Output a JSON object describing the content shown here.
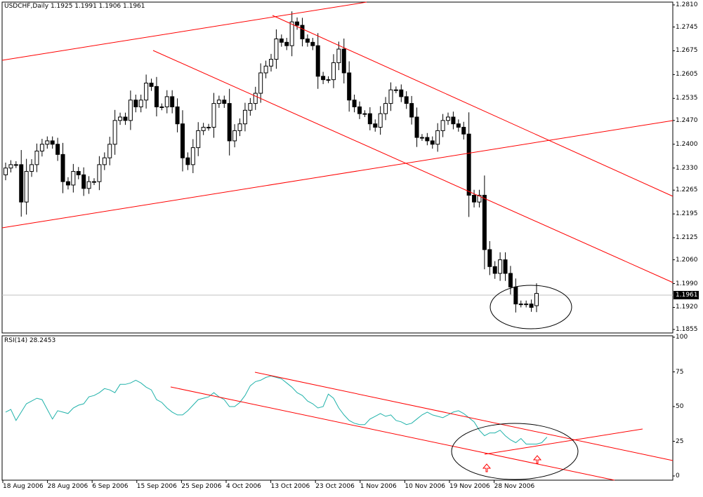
{
  "main_panel": {
    "header": "USDCHF,Daily  1.1925 1.1991 1.1906 1.1961",
    "current_price_label": "1.1961",
    "price_ticks": [
      "1.2810",
      "1.2745",
      "1.2675",
      "1.2605",
      "1.2535",
      "1.2470",
      "1.2400",
      "1.2330",
      "1.2265",
      "1.2195",
      "1.2125",
      "1.2060",
      "1.1990",
      "1.1920",
      "1.1855"
    ]
  },
  "rsi_panel": {
    "header": "RSI(14)  28.2453",
    "ticks": [
      "100",
      "75",
      "50",
      "25",
      "0"
    ]
  },
  "x_axis": {
    "labels": [
      "18 Aug 2006",
      "28 Aug 2006",
      "6 Sep 2006",
      "15 Sep 2006",
      "25 Sep 2006",
      "4 Oct 2006",
      "13 Oct 2006",
      "23 Oct 2006",
      "1 Nov 2006",
      "10 Nov 2006",
      "19 Nov 2006",
      "28 Nov 2006"
    ]
  },
  "colors": {
    "up_candle": "#ffffff",
    "down_candle": "#000000",
    "trendline": "#ff0000",
    "rsi_line": "#20b2aa",
    "arrow": "#ff0000"
  },
  "chart_data": [
    {
      "type": "candlestick",
      "title": "USDCHF,Daily",
      "symbol": "USDCHF",
      "timeframe": "Daily",
      "last_bar": {
        "open": 1.1925,
        "high": 1.1991,
        "low": 1.1906,
        "close": 1.1961
      },
      "ylim": [
        1.1855,
        1.281
      ],
      "x_labels": [
        "18 Aug 2006",
        "28 Aug 2006",
        "6 Sep 2006",
        "15 Sep 2006",
        "25 Sep 2006",
        "4 Oct 2006",
        "13 Oct 2006",
        "23 Oct 2006",
        "1 Nov 2006",
        "10 Nov 2006",
        "19 Nov 2006",
        "28 Nov 2006"
      ],
      "grid": false,
      "close": [
        1.233,
        1.234,
        1.234,
        1.223,
        1.232,
        1.234,
        1.238,
        1.24,
        1.241,
        1.24,
        1.237,
        1.229,
        1.228,
        1.232,
        1.231,
        1.227,
        1.229,
        1.229,
        1.234,
        1.236,
        1.24,
        1.247,
        1.248,
        1.247,
        1.253,
        1.251,
        1.253,
        1.258,
        1.257,
        1.251,
        1.251,
        1.254,
        1.251,
        1.246,
        1.236,
        1.234,
        1.239,
        1.244,
        1.245,
        1.245,
        1.252,
        1.253,
        1.252,
        1.241,
        1.244,
        1.246,
        1.25,
        1.252,
        1.255,
        1.261,
        1.263,
        1.265,
        1.271,
        1.27,
        1.269,
        1.276,
        1.275,
        1.271,
        1.27,
        1.269,
        1.26,
        1.259,
        1.259,
        1.264,
        1.268,
        1.261,
        1.253,
        1.251,
        1.249,
        1.249,
        1.246,
        1.245,
        1.249,
        1.252,
        1.256,
        1.256,
        1.254,
        1.252,
        1.248,
        1.242,
        1.242,
        1.241,
        1.24,
        1.244,
        1.247,
        1.248,
        1.246,
        1.245,
        1.243,
        1.225,
        1.223,
        1.225,
        1.209,
        1.204,
        1.202,
        1.206,
        1.202,
        1.198,
        1.193,
        1.193,
        1.193,
        1.192,
        1.1961
      ],
      "rsi_series": [
        46,
        48,
        40,
        46,
        52,
        54,
        56,
        55,
        48,
        41,
        47,
        46,
        45,
        49,
        51,
        52,
        57,
        58,
        60,
        63,
        62,
        60,
        66,
        66,
        67,
        69,
        67,
        64,
        62,
        55,
        53,
        49,
        46,
        44,
        44,
        47,
        51,
        55,
        56,
        57,
        60,
        57,
        55,
        50,
        50,
        53,
        58,
        65,
        68,
        69,
        71,
        72,
        71,
        70,
        67,
        64,
        60,
        58,
        54,
        52,
        49,
        50,
        59,
        56,
        49,
        44,
        40,
        38,
        37,
        37,
        41,
        43,
        45,
        43,
        44,
        40,
        39,
        37,
        38,
        41,
        44,
        46,
        44,
        43,
        42,
        44,
        46,
        47,
        45,
        42,
        39,
        33,
        29,
        31,
        31,
        33,
        29,
        26,
        24,
        27,
        23,
        23,
        23,
        24,
        28
      ]
    },
    {
      "type": "line",
      "title": "RSI(14)",
      "indicator": "RSI",
      "period": 14,
      "last_value": 28.2453,
      "ylim": [
        0,
        100
      ],
      "yticks": [
        0,
        25,
        50,
        75,
        100
      ]
    }
  ]
}
